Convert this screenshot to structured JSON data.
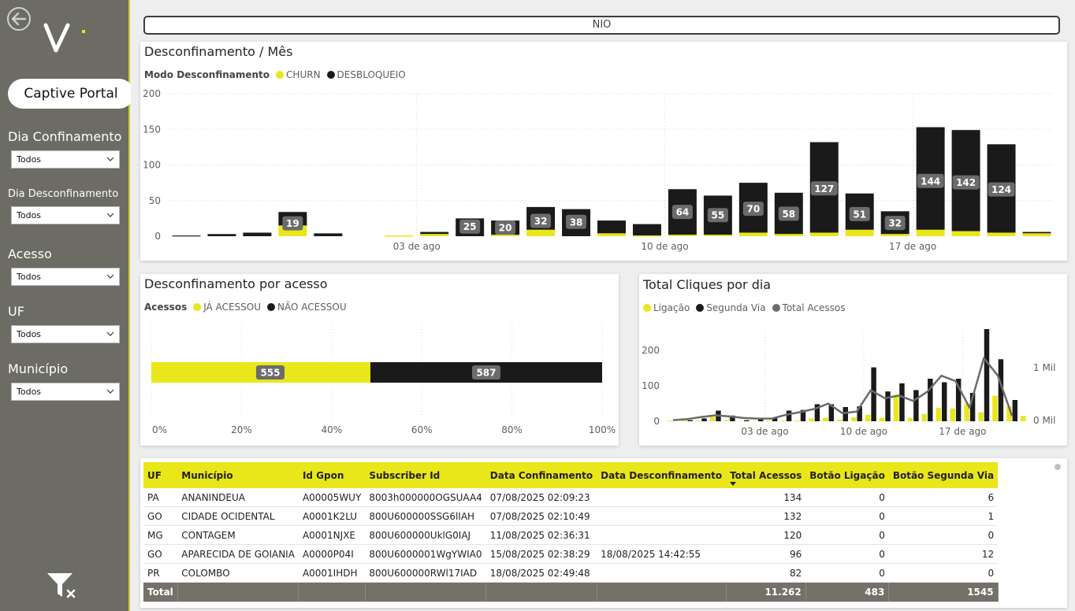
{
  "sidebar": {
    "captive_label": "Captive Portal",
    "filters": [
      {
        "label": "Dia Confinamento",
        "value": "Todos"
      },
      {
        "label": "Dia Desconfinamento",
        "value": "Todos"
      },
      {
        "label": "Acesso",
        "value": "Todos"
      },
      {
        "label": "UF",
        "value": "Todos"
      },
      {
        "label": "Município",
        "value": "Todos"
      }
    ]
  },
  "header": {
    "nio_label": "NIO"
  },
  "colors": {
    "yellow": "#e9e71a",
    "black": "#1a1a1a",
    "gray": "#6b6b6b",
    "sidebar": "#6c6c64"
  },
  "chart_data": [
    {
      "type": "bar",
      "title": "Desconfinamento / Mês",
      "legend_title": "Modo Desconfinamento",
      "series_names": [
        "CHURN",
        "DESBLOQUEIO"
      ],
      "ylim": [
        0,
        200
      ],
      "yticks": [
        0,
        50,
        100,
        150,
        200
      ],
      "xtick_labels": [
        {
          "label": "03 de ago",
          "index": 6.5
        },
        {
          "label": "10 de ago",
          "index": 13.5
        },
        {
          "label": "17 de ago",
          "index": 20.5
        }
      ],
      "bars": [
        {
          "churn": 0,
          "desbloqueio": 1,
          "label": ""
        },
        {
          "churn": 0,
          "desbloqueio": 3,
          "label": ""
        },
        {
          "churn": 0,
          "desbloqueio": 5,
          "label": ""
        },
        {
          "churn": 15,
          "desbloqueio": 19,
          "label": "19"
        },
        {
          "churn": 0,
          "desbloqueio": 4,
          "label": ""
        },
        {
          "churn": 0,
          "desbloqueio": 0,
          "label": ""
        },
        {
          "churn": 1,
          "desbloqueio": 0,
          "label": ""
        },
        {
          "churn": 3,
          "desbloqueio": 3,
          "label": ""
        },
        {
          "churn": 0,
          "desbloqueio": 25,
          "label": "25"
        },
        {
          "churn": 2,
          "desbloqueio": 20,
          "label": "20"
        },
        {
          "churn": 9,
          "desbloqueio": 32,
          "label": "32"
        },
        {
          "churn": 0,
          "desbloqueio": 38,
          "label": "38"
        },
        {
          "churn": 4,
          "desbloqueio": 18,
          "label": ""
        },
        {
          "churn": 1,
          "desbloqueio": 16,
          "label": ""
        },
        {
          "churn": 2,
          "desbloqueio": 64,
          "label": "64"
        },
        {
          "churn": 2,
          "desbloqueio": 55,
          "label": "55"
        },
        {
          "churn": 5,
          "desbloqueio": 70,
          "label": "70"
        },
        {
          "churn": 3,
          "desbloqueio": 58,
          "label": "58"
        },
        {
          "churn": 5,
          "desbloqueio": 127,
          "label": "127"
        },
        {
          "churn": 9,
          "desbloqueio": 51,
          "label": "51"
        },
        {
          "churn": 3,
          "desbloqueio": 32,
          "label": "32"
        },
        {
          "churn": 9,
          "desbloqueio": 144,
          "label": "144"
        },
        {
          "churn": 7,
          "desbloqueio": 142,
          "label": "142"
        },
        {
          "churn": 5,
          "desbloqueio": 124,
          "label": "124"
        },
        {
          "churn": 4,
          "desbloqueio": 2,
          "label": ""
        }
      ]
    },
    {
      "type": "bar",
      "orientation": "horizontal-100%",
      "title": "Desconfinamento por acesso",
      "legend_title": "Acessos",
      "series": [
        {
          "name": "JÁ ACESSOU",
          "value": 555
        },
        {
          "name": "NÃO ACESSOU",
          "value": 587
        }
      ],
      "xticks": [
        "0%",
        "20%",
        "40%",
        "60%",
        "80%",
        "100%"
      ]
    },
    {
      "type": "bar",
      "title": "Total Cliques por dia",
      "series_names": [
        "Ligação",
        "Segunda Via",
        "Total Acessos"
      ],
      "ylim": [
        0,
        250
      ],
      "yticks": [
        0,
        100,
        200
      ],
      "y2_labels": [
        "0 Mil",
        "1 Mil"
      ],
      "xtick_labels": [
        {
          "label": "03 de ago",
          "index": 6.5
        },
        {
          "label": "10 de ago",
          "index": 13.5
        },
        {
          "label": "17 de ago",
          "index": 20.5
        }
      ],
      "ligacao": [
        2,
        3,
        2,
        12,
        3,
        1,
        1,
        2,
        2,
        2,
        8,
        10,
        5,
        11,
        18,
        10,
        75,
        10,
        20,
        38,
        36,
        50,
        25,
        72,
        42,
        15
      ],
      "segunda_via": [
        0,
        3,
        8,
        30,
        16,
        3,
        6,
        9,
        30,
        32,
        48,
        48,
        40,
        42,
        152,
        84,
        107,
        88,
        120,
        110,
        120,
        80,
        260,
        175,
        60,
        0
      ],
      "total_acessos_line": [
        0.02,
        0.04,
        0.08,
        0.11,
        0.09,
        0.06,
        0.05,
        0.05,
        0.12,
        0.17,
        0.23,
        0.33,
        0.15,
        0.18,
        0.58,
        0.43,
        0.48,
        0.38,
        0.55,
        0.85,
        0.75,
        0.25,
        1.18,
        0.85,
        0.1
      ]
    }
  ],
  "table": {
    "headers": [
      "UF",
      "Município",
      "Id Gpon",
      "Subscriber Id",
      "Data Confinamento",
      "Data Desconfinamento",
      "Total Acessos",
      "Botão Ligação",
      "Botão Segunda Via"
    ],
    "rows": [
      [
        "PA",
        "ANANINDEUA",
        "A00005WUY",
        "8003h000000OGSUAA4",
        "07/08/2025 02:09:23",
        "",
        "134",
        "0",
        "6"
      ],
      [
        "GO",
        "CIDADE OCIDENTAL",
        "A0001K2LU",
        "800U600000SSG6lIAH",
        "07/08/2025 02:10:49",
        "",
        "132",
        "0",
        "1"
      ],
      [
        "MG",
        "CONTAGEM",
        "A0001NJXE",
        "800U600000UklG0IAJ",
        "11/08/2025 02:36:31",
        "",
        "120",
        "0",
        "0"
      ],
      [
        "GO",
        "APARECIDA DE GOIANIA",
        "A0000P04I",
        "800U6000001WgYWIA0",
        "15/08/2025 02:38:29",
        "18/08/2025 14:42:55",
        "96",
        "0",
        "12"
      ],
      [
        "PR",
        "COLOMBO",
        "A0001IHDH",
        "800U600000RWl17IAD",
        "18/08/2025 02:49:48",
        "",
        "82",
        "0",
        "0"
      ]
    ],
    "total": {
      "label": "Total",
      "total_acessos": "11.262",
      "botao_ligacao": "483",
      "botao_segunda_via": "1545"
    }
  }
}
